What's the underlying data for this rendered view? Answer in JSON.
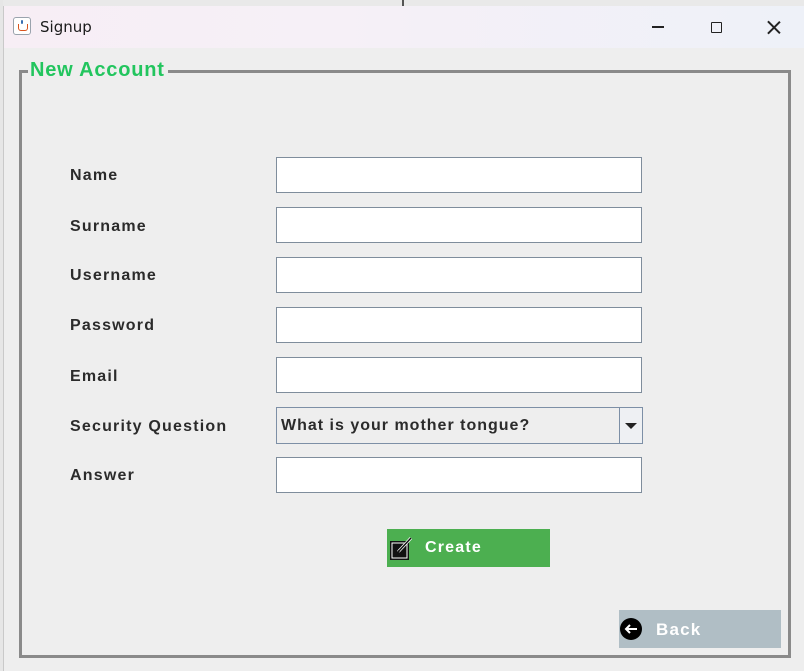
{
  "window": {
    "title": "Signup"
  },
  "form": {
    "legend": "New Account",
    "fields": [
      {
        "label": "Name",
        "value": ""
      },
      {
        "label": "Surname",
        "value": ""
      },
      {
        "label": "Username",
        "value": ""
      },
      {
        "label": "Password",
        "value": ""
      },
      {
        "label": "Email",
        "value": ""
      },
      {
        "label": "Security Question",
        "selected": "What is your mother tongue?"
      },
      {
        "label": "Answer",
        "value": ""
      }
    ]
  },
  "buttons": {
    "create_label": "Create",
    "create_icon": "edit-icon",
    "back_label": "Back",
    "back_icon": "arrow-left-circle-icon"
  },
  "colors": {
    "legend": "#22c55e",
    "create_button": "#4caf50",
    "back_button": "#b0bec5"
  }
}
